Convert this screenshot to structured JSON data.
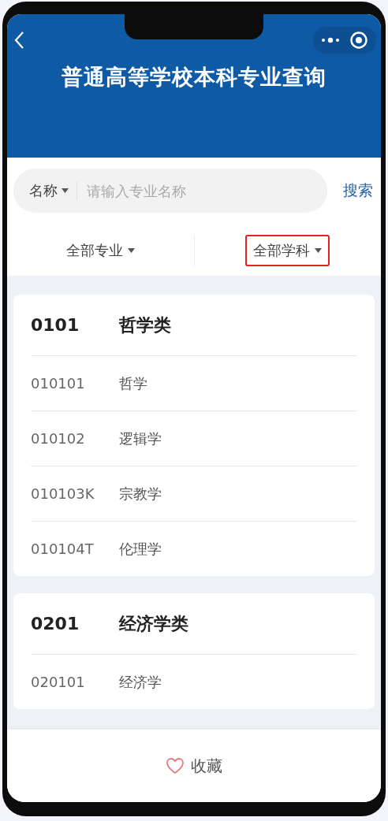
{
  "header": {
    "title": "普通高等学校本科专业查询"
  },
  "search": {
    "scope": "名称",
    "placeholder": "请输入专业名称",
    "button": "搜索"
  },
  "filters": [
    {
      "label": "全部专业",
      "highlighted": false
    },
    {
      "label": "全部学科",
      "highlighted": true
    }
  ],
  "groups": [
    {
      "code": "0101",
      "name": "哲学类",
      "majors": [
        {
          "code": "010101",
          "name": "哲学"
        },
        {
          "code": "010102",
          "name": "逻辑学"
        },
        {
          "code": "010103K",
          "name": "宗教学"
        },
        {
          "code": "010104T",
          "name": "伦理学"
        }
      ]
    },
    {
      "code": "0201",
      "name": "经济学类",
      "majors": [
        {
          "code": "020101",
          "name": "经济学"
        }
      ]
    }
  ],
  "footer": {
    "favorite": "收藏"
  }
}
